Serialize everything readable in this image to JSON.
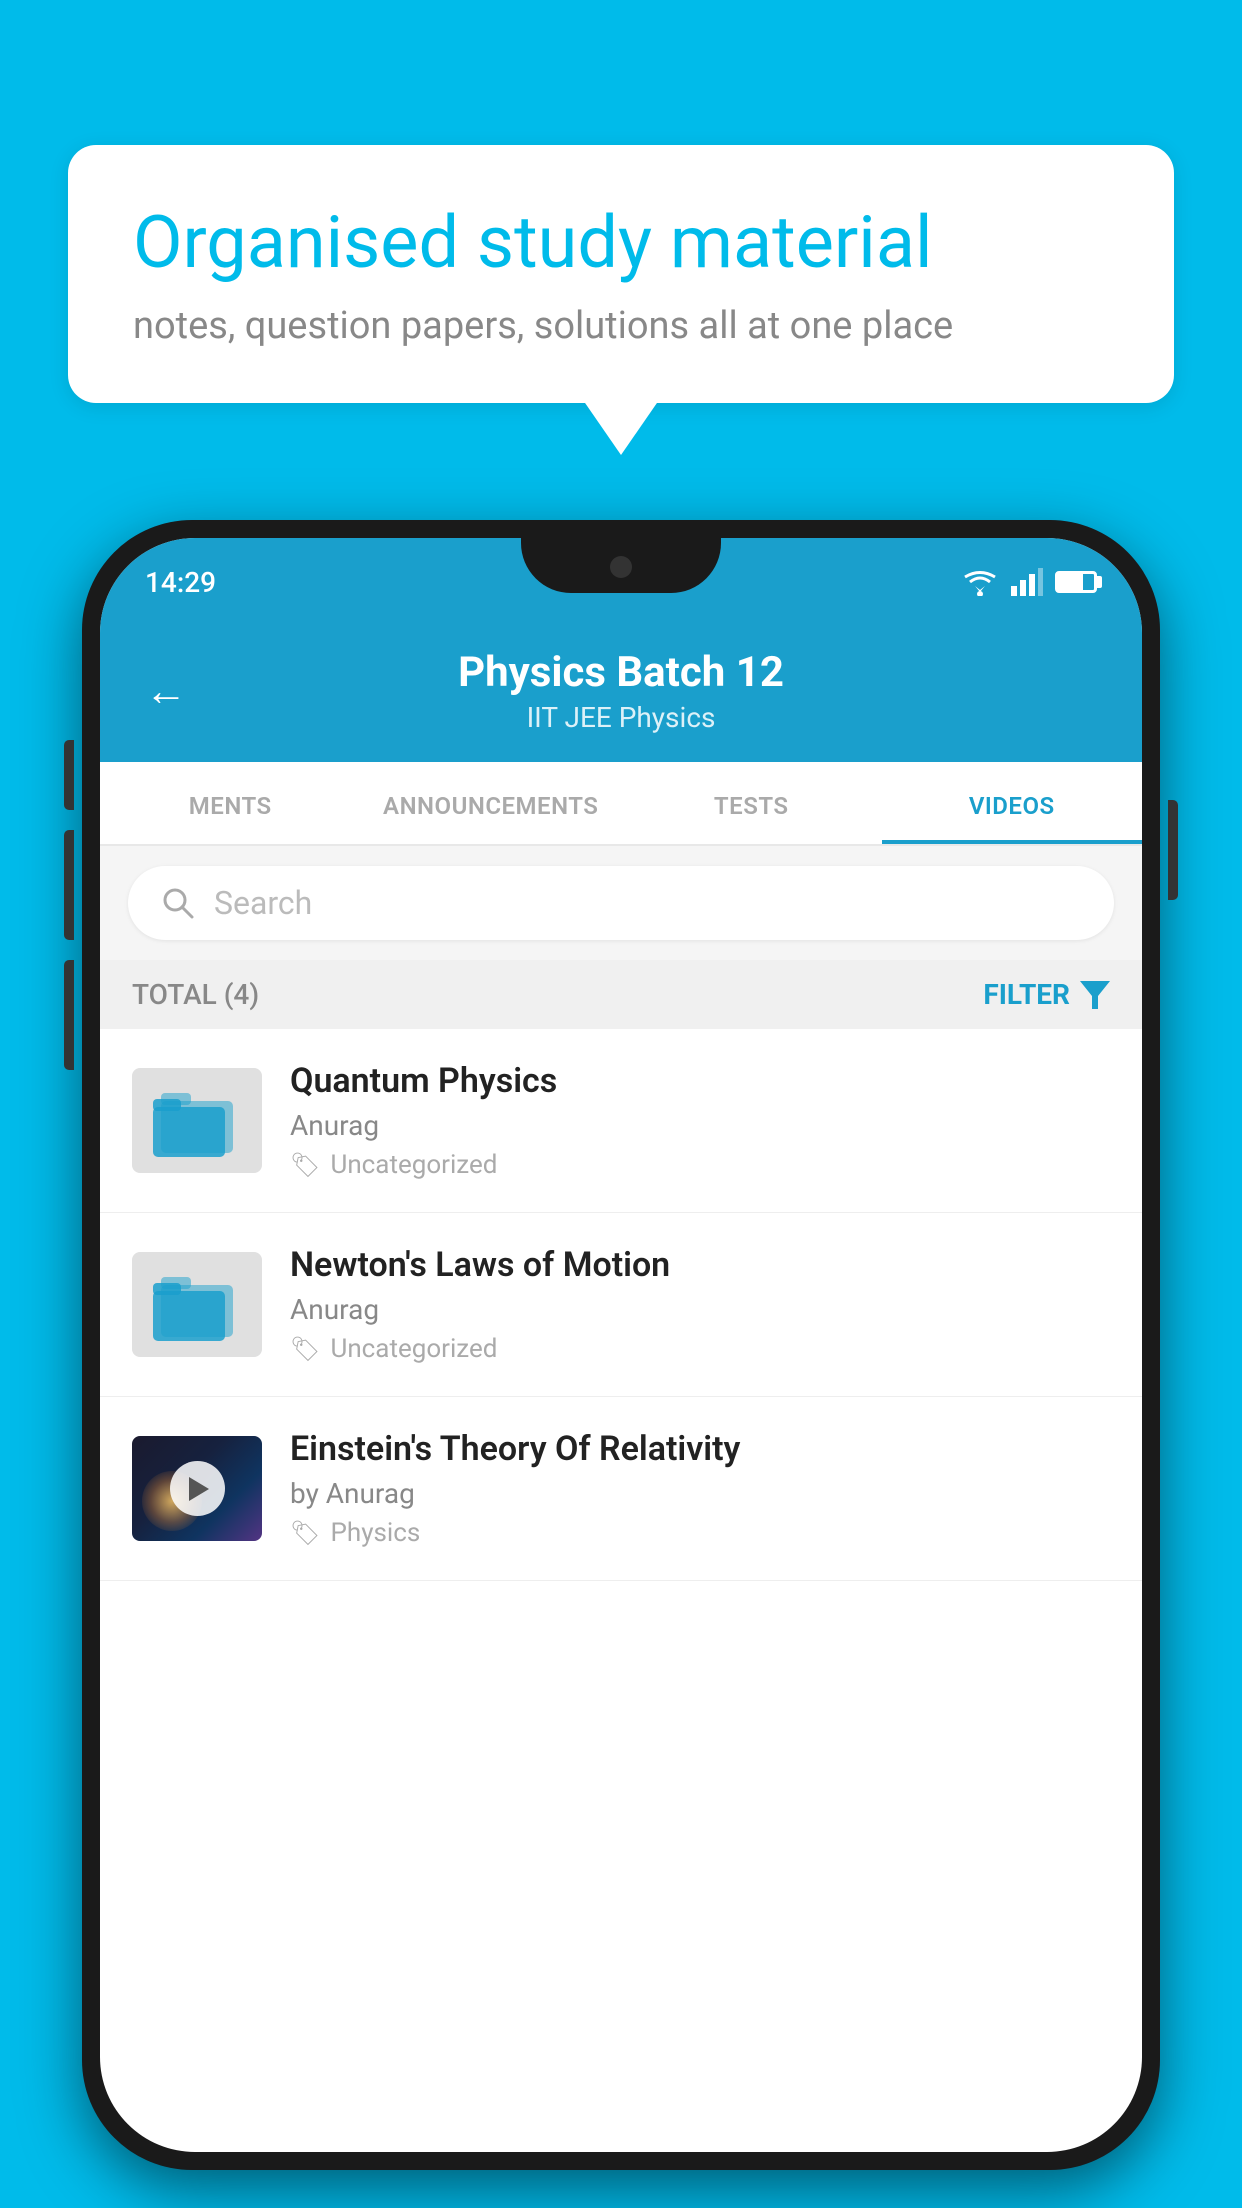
{
  "background_color": "#00BBEA",
  "speech_bubble": {
    "title": "Organised study material",
    "subtitle": "notes, question papers, solutions all at one place"
  },
  "phone": {
    "status_bar": {
      "time": "14:29"
    },
    "header": {
      "title": "Physics Batch 12",
      "subtitle": "IIT JEE   Physics",
      "back_label": "←"
    },
    "tabs": [
      {
        "label": "MENTS",
        "active": false
      },
      {
        "label": "ANNOUNCEMENTS",
        "active": false
      },
      {
        "label": "TESTS",
        "active": false
      },
      {
        "label": "VIDEOS",
        "active": true
      }
    ],
    "search": {
      "placeholder": "Search"
    },
    "filter": {
      "total_label": "TOTAL (4)",
      "filter_label": "FILTER"
    },
    "videos": [
      {
        "id": 1,
        "title": "Quantum Physics",
        "author": "Anurag",
        "tag": "Uncategorized",
        "has_thumbnail": false
      },
      {
        "id": 2,
        "title": "Newton's Laws of Motion",
        "author": "Anurag",
        "tag": "Uncategorized",
        "has_thumbnail": false
      },
      {
        "id": 3,
        "title": "Einstein's Theory Of Relativity",
        "author": "by Anurag",
        "tag": "Physics",
        "has_thumbnail": true
      }
    ]
  }
}
